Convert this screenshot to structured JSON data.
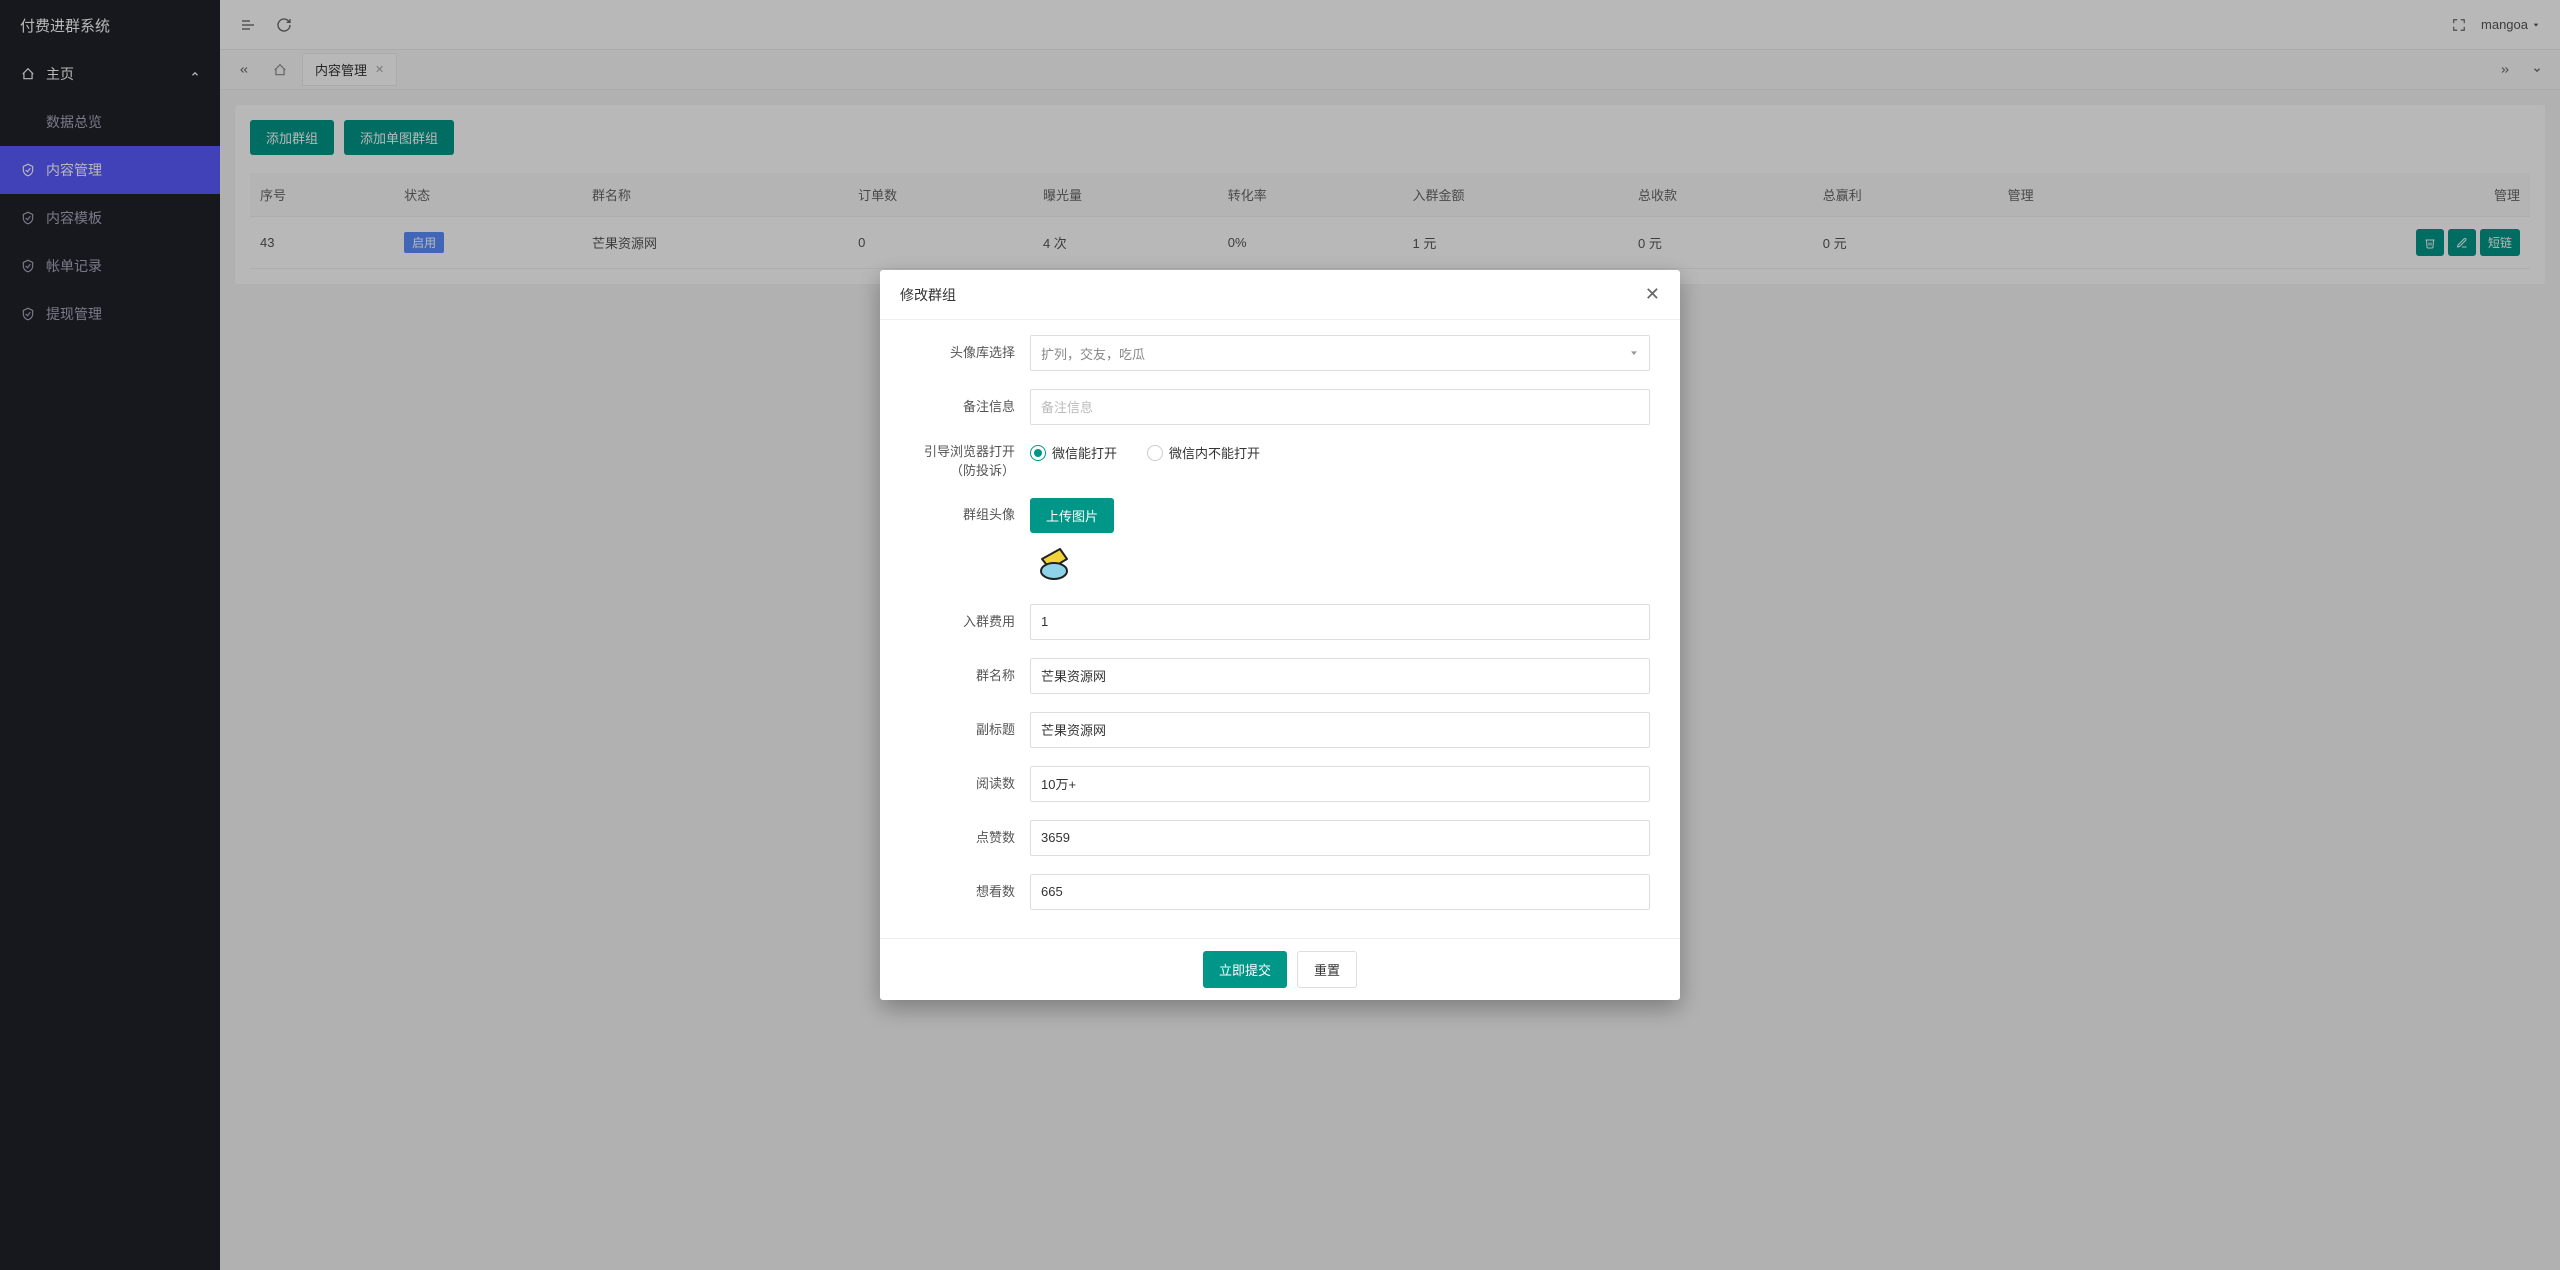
{
  "app_name": "付费进群系统",
  "user_name": "mangoa",
  "sidebar": {
    "main_label": "主页",
    "items": [
      {
        "label": "数据总览",
        "icon": "dashboard"
      },
      {
        "label": "内容管理",
        "icon": "shield",
        "active": true
      },
      {
        "label": "内容模板",
        "icon": "shield"
      },
      {
        "label": "帐单记录",
        "icon": "shield"
      },
      {
        "label": "提现管理",
        "icon": "shield"
      }
    ]
  },
  "tabs": {
    "current": "内容管理"
  },
  "toolbar": {
    "add_group": "添加群组",
    "add_single_image_group": "添加单图群组"
  },
  "table": {
    "headers": [
      "序号",
      "状态",
      "群名称",
      "订单数",
      "曝光量",
      "转化率",
      "入群金额",
      "总收款",
      "总赢利",
      "管理",
      "管理"
    ],
    "rows": [
      {
        "id": "43",
        "status": "启用",
        "name": "芒果资源网",
        "orders": "0",
        "exposure": "4 次",
        "conversion": "0%",
        "join_amount": "1 元",
        "total_received": "0 元",
        "total_profit": "0 元"
      }
    ],
    "actions": {
      "delete_icon": "🗑",
      "edit_icon": "✎",
      "short_link": "短链"
    }
  },
  "modal": {
    "title": "修改群组",
    "submit": "立即提交",
    "reset": "重置",
    "fields": {
      "avatar_lib_label": "头像库选择",
      "avatar_lib_value": "扩列，交友，吃瓜",
      "remark_label": "备注信息",
      "remark_placeholder": "备注信息",
      "browser_guide_label": "引导浏览器打开（防投诉）",
      "browser_opt1": "微信能打开",
      "browser_opt2": "微信内不能打开",
      "avatar_label": "群组头像",
      "upload_btn": "上传图片",
      "join_fee_label": "入群费用",
      "join_fee_value": "1",
      "group_name_label": "群名称",
      "group_name_value": "芒果资源网",
      "subtitle_label": "副标题",
      "subtitle_value": "芒果资源网",
      "reads_label": "阅读数",
      "reads_value": "10万+",
      "likes_label": "点赞数",
      "likes_value": "3659",
      "wants_label": "想看数",
      "wants_value": "665"
    }
  }
}
